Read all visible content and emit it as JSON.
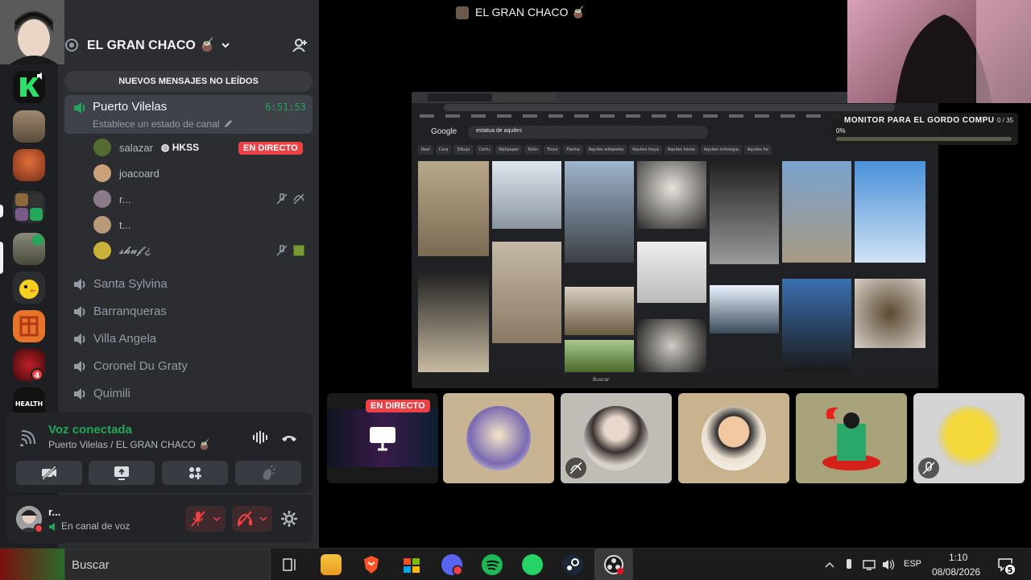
{
  "server": {
    "name": "EL GRAN CHACO 🧉",
    "unread_banner": "NUEVOS MENSAJES NO LEÍDOS"
  },
  "rail": {
    "badge_count": "4",
    "health_label": "HEALTH"
  },
  "active_channel": {
    "name": "Puerto Vilelas",
    "timer": "6:51:53",
    "status_placeholder": "Establece un estado de canal"
  },
  "members": [
    {
      "name": "salazar",
      "tag": "HKSS",
      "live": "EN DIRECTO"
    },
    {
      "name": "joacoard"
    },
    {
      "name": "r..."
    },
    {
      "name": "t..."
    },
    {
      "name": "𝓼𝓱𝓾𝓯 ¿"
    }
  ],
  "channels": [
    "Santa Sylvina",
    "Barranqueras",
    "Villa Angela",
    "Coronel Du Graty",
    "Quimili"
  ],
  "voice": {
    "status": "Voz conectada",
    "location": "Puerto Vilelas / EL GRAN CHACO 🧉"
  },
  "user": {
    "name": "r...",
    "status": "En canal de voz"
  },
  "stage": {
    "title": "EL GRAN CHACO 🧉",
    "live_label": "EN DIRECTO",
    "overlay_title": "MONITOR PARA EL GORDO COMPU",
    "overlay_count": "0 / 35",
    "overlay_percent": "0%",
    "overlay_progress": 0,
    "browser_search": "estatua de aquiles",
    "browser_brand": "Google",
    "browser_chips": [
      "Real",
      "Cara",
      "Dibujo",
      "Corfu",
      "Wallpaper",
      "Talón",
      "Troya",
      "Flecha",
      "Aquiles wikipedia",
      "Aquiles troya",
      "Aquiles héroe",
      "Aquiles mitologia",
      "Aquiles he"
    ],
    "browser_taskbar_search": "Buscar"
  },
  "taskbar": {
    "search_placeholder": "Buscar",
    "language": "ESP",
    "time": "1:10",
    "date": "08/08/2026",
    "notification_count": "5"
  },
  "colors": {
    "accent_green": "#23a55a",
    "live_red": "#ed4245",
    "sidebar_bg": "#2b2d31",
    "rail_bg": "#1e1f22"
  }
}
